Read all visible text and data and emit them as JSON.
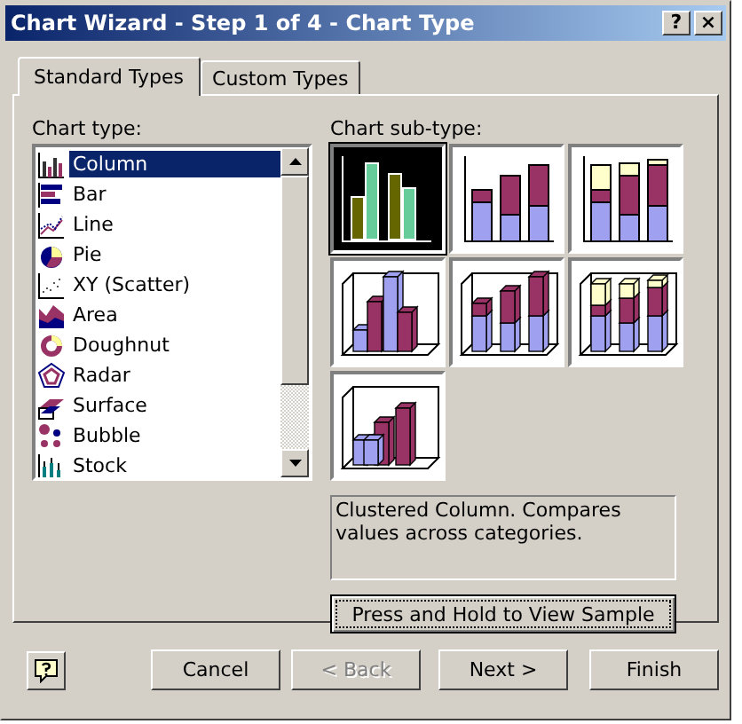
{
  "window": {
    "title": "Chart Wizard - Step 1 of 4 - Chart Type",
    "title_buttons": [
      "?",
      "×"
    ]
  },
  "tabs": [
    {
      "label": "Standard Types",
      "selected": true
    },
    {
      "label": "Custom Types",
      "selected": false
    }
  ],
  "chart_type": {
    "label": "Chart type:",
    "items": [
      {
        "label": "Column",
        "selected": true
      },
      {
        "label": "Bar",
        "selected": false
      },
      {
        "label": "Line",
        "selected": false
      },
      {
        "label": "Pie",
        "selected": false
      },
      {
        "label": "XY (Scatter)",
        "selected": false
      },
      {
        "label": "Area",
        "selected": false
      },
      {
        "label": "Doughnut",
        "selected": false
      },
      {
        "label": "Radar",
        "selected": false
      },
      {
        "label": "Surface",
        "selected": false
      },
      {
        "label": "Bubble",
        "selected": false
      },
      {
        "label": "Stock",
        "selected": false
      }
    ]
  },
  "sub_type": {
    "label": "Chart sub-type:",
    "items": [
      {
        "kind": "clustered",
        "selected": true
      },
      {
        "kind": "stacked",
        "selected": false
      },
      {
        "kind": "percent",
        "selected": false
      },
      {
        "kind": "clustered3d",
        "selected": false
      },
      {
        "kind": "stacked3d",
        "selected": false
      },
      {
        "kind": "percent3d",
        "selected": false
      },
      {
        "kind": "column3d",
        "selected": false
      }
    ]
  },
  "description": "Clustered Column. Compares values across categories.",
  "sample_button": "Press and Hold to View Sample",
  "buttons": [
    {
      "label": "Cancel",
      "disabled": false
    },
    {
      "label": "< Back",
      "disabled": true
    },
    {
      "label": "Next >",
      "disabled": false
    },
    {
      "label": "Finish",
      "disabled": false
    }
  ]
}
